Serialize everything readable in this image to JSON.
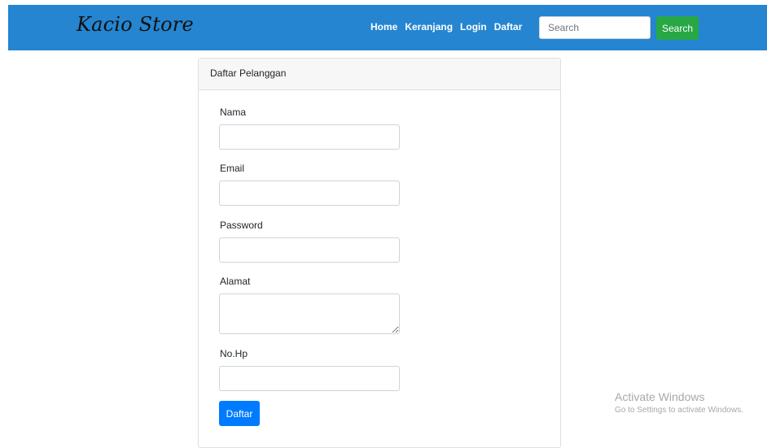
{
  "header": {
    "brand": "Kacio Store",
    "nav": [
      {
        "label": "Home"
      },
      {
        "label": "Keranjang"
      },
      {
        "label": "Login"
      },
      {
        "label": "Daftar"
      }
    ],
    "search": {
      "placeholder": "Search",
      "value": "",
      "button_label": "Search"
    },
    "colors": {
      "navbar": "#2585d0",
      "search_button": "#28a745"
    }
  },
  "form": {
    "title": "Daftar Pelanggan",
    "fields": [
      {
        "label": "Nama",
        "value": ""
      },
      {
        "label": "Email",
        "value": ""
      },
      {
        "label": "Password",
        "value": ""
      },
      {
        "label": "Alamat",
        "value": ""
      },
      {
        "label": "No.Hp",
        "value": ""
      }
    ],
    "submit_label": "Daftar",
    "colors": {
      "submit": "#007bff"
    }
  },
  "watermark": {
    "title": "Activate Windows",
    "subtitle": "Go to Settings to activate Windows."
  }
}
